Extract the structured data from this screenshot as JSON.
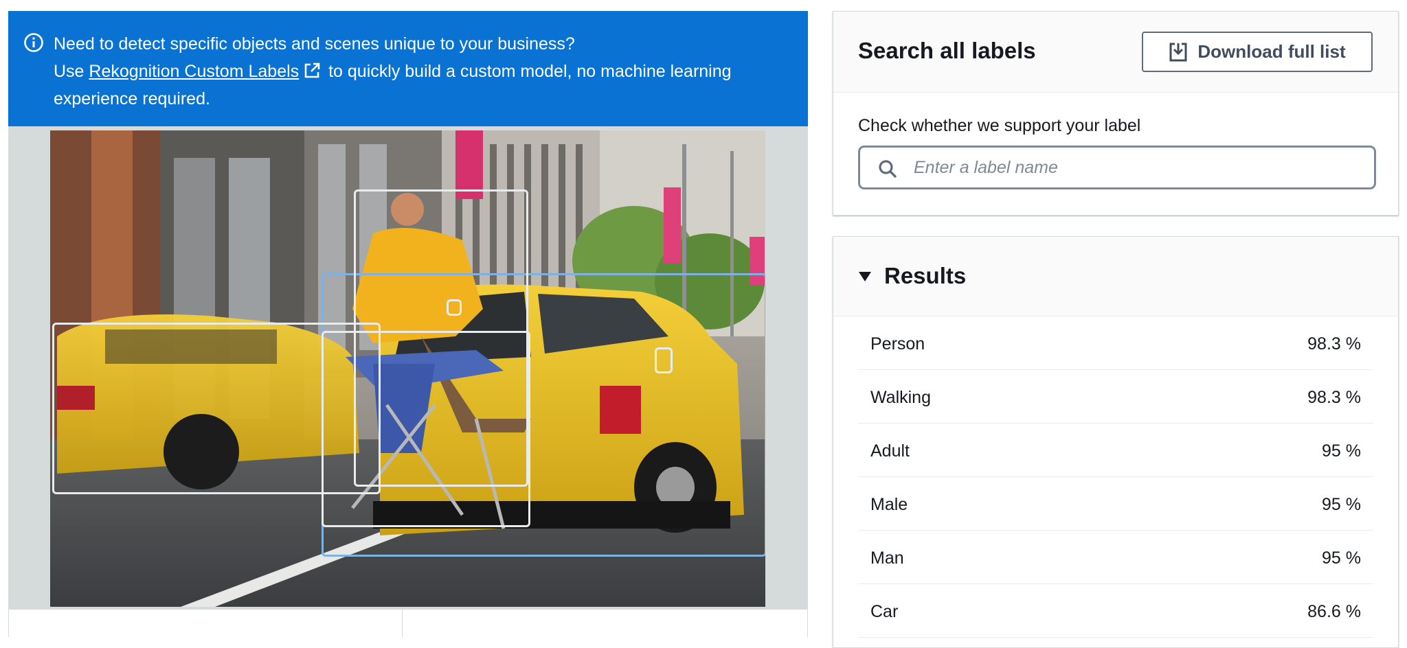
{
  "banner": {
    "line1": "Need to detect specific objects and scenes unique to your business?",
    "line2_prefix": "Use",
    "link_text": "Rekognition Custom Labels",
    "line2_suffix": "to quickly build a custom model, no machine learning",
    "line3": "experience required.",
    "color": "#0972d3"
  },
  "search": {
    "title": "Search all labels",
    "download_label": "Download full list",
    "check_label": "Check whether we support your label",
    "placeholder": "Enter a label name",
    "value": ""
  },
  "results": {
    "title": "Results",
    "expanded": true,
    "items": [
      {
        "label": "Person",
        "confidence": "98.3 %"
      },
      {
        "label": "Walking",
        "confidence": "98.3 %"
      },
      {
        "label": "Adult",
        "confidence": "95 %"
      },
      {
        "label": "Male",
        "confidence": "95 %"
      },
      {
        "label": "Man",
        "confidence": "95 %"
      },
      {
        "label": "Car",
        "confidence": "86.6 %"
      }
    ]
  },
  "icons": {
    "info": "info-icon",
    "external": "external-link-icon",
    "download": "download-icon",
    "search": "search-icon",
    "caret": "caret-down-icon"
  }
}
